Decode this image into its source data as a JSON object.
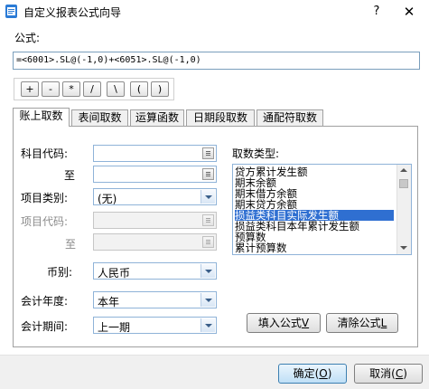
{
  "window": {
    "title": "自定义报表公式向导",
    "help_label": "?",
    "close_label": "✕",
    "icon": "report-formula-icon"
  },
  "formula": {
    "label": "公式:",
    "value": "=<6001>.SL@(-1,0)+<6051>.SL@(-1,0)"
  },
  "operators": [
    "+",
    "-",
    "*",
    "/",
    "\\",
    "(",
    ")"
  ],
  "tabs": [
    {
      "label": "账上取数",
      "active": true
    },
    {
      "label": "表间取数",
      "active": false
    },
    {
      "label": "运算函数",
      "active": false
    },
    {
      "label": "日期段取数",
      "active": false
    },
    {
      "label": "通配符取数",
      "active": false
    }
  ],
  "form": {
    "account_code_label": "科目代码:",
    "account_to_label": "至",
    "item_category_label": "项目类别:",
    "item_category_value": "(无)",
    "item_code_label": "项目代码:",
    "item_to_label": "至",
    "currency_label": "币别:",
    "currency_value": "人民币",
    "fiscal_year_label": "会计年度:",
    "fiscal_year_value": "本年",
    "fiscal_period_label": "会计期间:",
    "fiscal_period_value": "上一期"
  },
  "fetch_type": {
    "label": "取数类型:",
    "items": [
      "贷方累计发生额",
      "期末余额",
      "期末借方余额",
      "期末贷方余额",
      "损益类科目实际发生额",
      "损益类科目本年累计发生额",
      "预算数",
      "累计预算数"
    ],
    "selected_index": 4
  },
  "buttons": {
    "insert_formula": "填入公式",
    "insert_formula_key": "V",
    "clear_formula": "清除公式",
    "clear_formula_key": "L",
    "ok": "确定",
    "ok_key": "O",
    "cancel": "取消",
    "cancel_key": "C"
  },
  "colors": {
    "selection": "#2f6fd1",
    "input_border": "#8fb3d8",
    "dialog_bg": "#f0f0f0"
  }
}
